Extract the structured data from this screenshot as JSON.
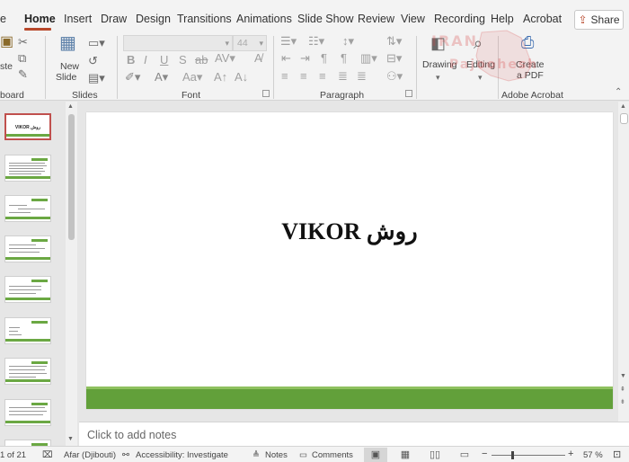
{
  "tabs": [
    "e",
    "Home",
    "Insert",
    "Draw",
    "Design",
    "Transitions",
    "Animations",
    "Slide Show",
    "Review",
    "View",
    "Recording",
    "Help",
    "Acrobat"
  ],
  "share_label": "Share",
  "ribbon": {
    "clipboard_label": "board",
    "slides_label": "Slides",
    "font_label": "Font",
    "paragraph_label": "Paragraph",
    "acrobat_label": "Adobe Acrobat",
    "paste_text": "ste",
    "new_slide_line1": "New",
    "new_slide_line2": "Slide",
    "font_size_value": "44",
    "drawing_label": "Drawing",
    "editing_label": "Editing",
    "create_pdf_line1": "Create",
    "create_pdf_line2": "a PDF"
  },
  "watermark": {
    "line1": "IRAN",
    "line2": "Pajoohesh"
  },
  "slide": {
    "title": "روش VIKOR"
  },
  "thumb1_title": "VIKOR روش",
  "notes_placeholder": "Click to add notes",
  "status": {
    "slide_counter": "1 of 21",
    "language": "Afar (Djibouti)",
    "accessibility": "Accessibility: Investigate",
    "notes": "Notes",
    "comments": "Comments",
    "zoom": "57 %",
    "zoom_fraction": 0.57
  },
  "colors": {
    "accent": "#b7472a",
    "slide_bar": "#62a03a"
  }
}
